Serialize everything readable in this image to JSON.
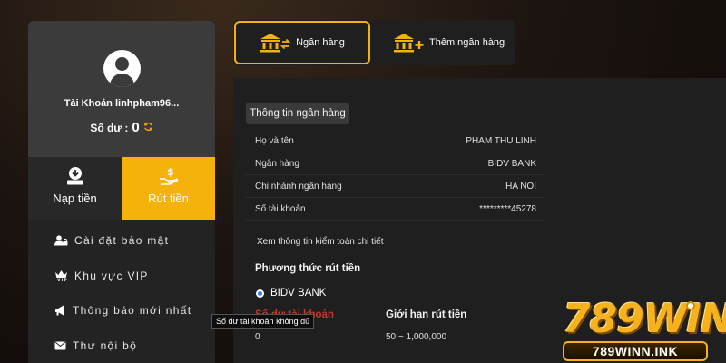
{
  "profile": {
    "account_label": "Tài Khoản linhpham96...",
    "balance_label": "Số dư :",
    "balance_value": "0"
  },
  "actions": {
    "deposit_label": "Nạp tiền",
    "withdraw_label": "Rút tiền"
  },
  "menu": [
    {
      "label": "Cài đặt bảo mật",
      "icon": "user-lock-icon"
    },
    {
      "label": "Khu vực VIP",
      "icon": "crown-icon"
    },
    {
      "label": "Thông báo mới nhất",
      "icon": "megaphone-icon"
    },
    {
      "label": "Thư nội bộ",
      "icon": "envelope-icon"
    }
  ],
  "tabs": {
    "bank_label": "Ngân hàng",
    "add_bank_label": "Thêm ngân hàng"
  },
  "bank_info": {
    "section_title": "Thông tin ngân hàng",
    "rows": [
      {
        "label": "Họ và tên",
        "value": "PHAM THU LINH"
      },
      {
        "label": "Ngân hàng",
        "value": "BIDV BANK"
      },
      {
        "label": "Chi nhánh ngân hàng",
        "value": "HA NOI"
      },
      {
        "label": "Số tài khoản",
        "value": "*********45278"
      }
    ],
    "audit_link": "Xem thông tin kiểm toán chi tiết"
  },
  "withdraw_method": {
    "title": "Phương thức rút tiền",
    "option": "BIDV BANK",
    "balance_col_header": "Số dư tài khoản",
    "limit_col_header": "Giới hạn rút tiền",
    "balance_value": "0",
    "limit_value": "50 ~ 1,000,000"
  },
  "tooltip": "Số dư tài khoản không đủ",
  "logo": {
    "brand": "789WIN",
    "url": "789WINN.INK"
  },
  "colors": {
    "accent": "#f5b20a",
    "panel": "#1f1f1f",
    "sidebar": "#232323",
    "warning_text": "#c0392b"
  }
}
